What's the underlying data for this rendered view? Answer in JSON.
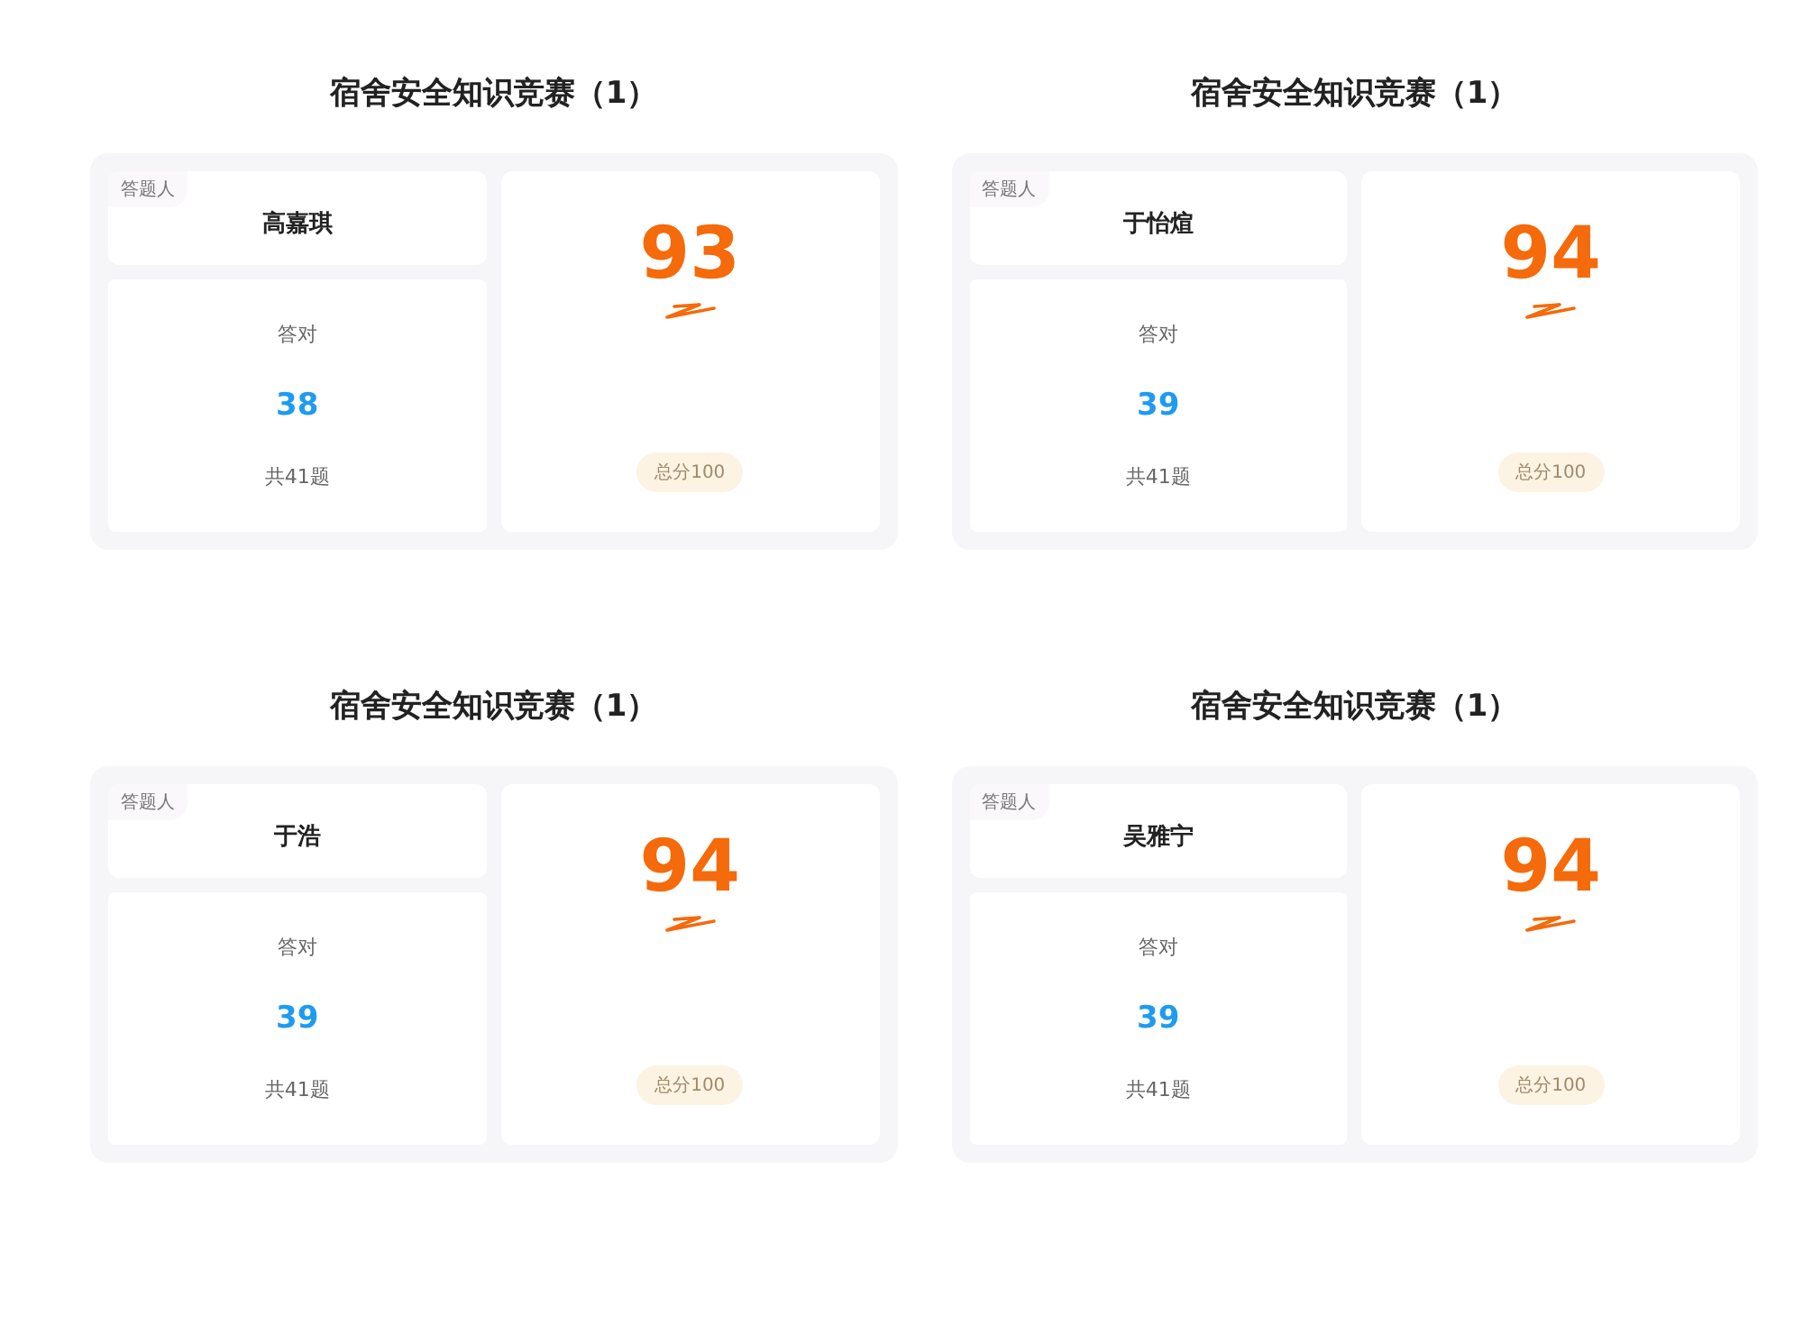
{
  "results": [
    {
      "title": "宿舍安全知识竞赛（1）",
      "respondent_label": "答题人",
      "name": "高嘉琪",
      "correct_label": "答对",
      "correct": "38",
      "total": "共41题",
      "score": "93",
      "full_score": "总分100"
    },
    {
      "title": "宿舍安全知识竞赛（1）",
      "respondent_label": "答题人",
      "name": "于怡煊",
      "correct_label": "答对",
      "correct": "39",
      "total": "共41题",
      "score": "94",
      "full_score": "总分100"
    },
    {
      "title": "宿舍安全知识竞赛（1）",
      "respondent_label": "答题人",
      "name": "于浩",
      "correct_label": "答对",
      "correct": "39",
      "total": "共41题",
      "score": "94",
      "full_score": "总分100"
    },
    {
      "title": "宿舍安全知识竞赛（1）",
      "respondent_label": "答题人",
      "name": "吴雅宁",
      "correct_label": "答对",
      "correct": "39",
      "total": "共41题",
      "score": "94",
      "full_score": "总分100"
    }
  ]
}
